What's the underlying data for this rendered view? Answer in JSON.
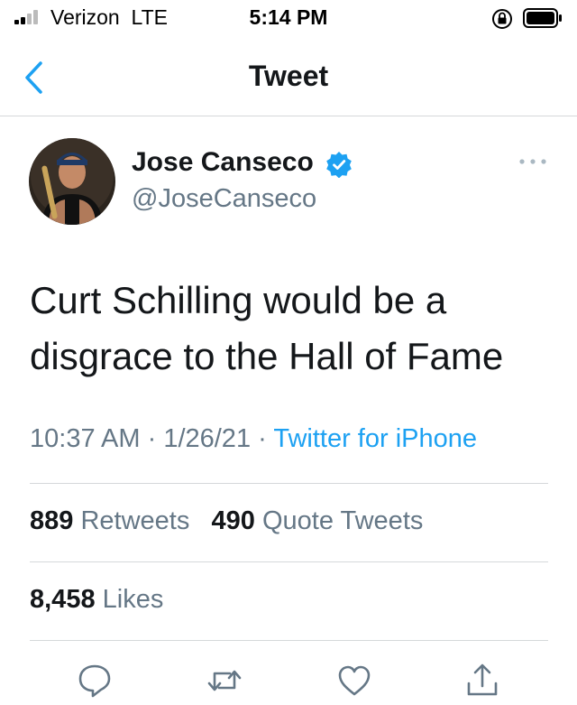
{
  "status_bar": {
    "carrier": "Verizon",
    "network": "LTE",
    "time": "5:14 PM"
  },
  "nav": {
    "title": "Tweet"
  },
  "author": {
    "name": "Jose Canseco",
    "handle": "@JoseCanseco",
    "verified": true
  },
  "tweet": {
    "text_line1": "Curt Schilling would be a",
    "text_line2": "disgrace to the Hall of Fame",
    "time": "10:37 AM",
    "date": "1/26/21",
    "source": "Twitter for iPhone"
  },
  "stats": {
    "retweets_count": "889",
    "retweets_label": "Retweets",
    "quote_count": "490",
    "quote_label": "Quote Tweets",
    "likes_count": "8,458",
    "likes_label": "Likes"
  },
  "colors": {
    "accent": "#1da1f2",
    "text": "#14171a",
    "muted": "#657786",
    "divider": "#d5d8da"
  },
  "icons": [
    "back-chevron-icon",
    "verified-badge-icon",
    "more-icon",
    "reply-icon",
    "retweet-icon",
    "like-icon",
    "share-icon",
    "lock-rotation-icon",
    "battery-icon",
    "signal-icon"
  ]
}
